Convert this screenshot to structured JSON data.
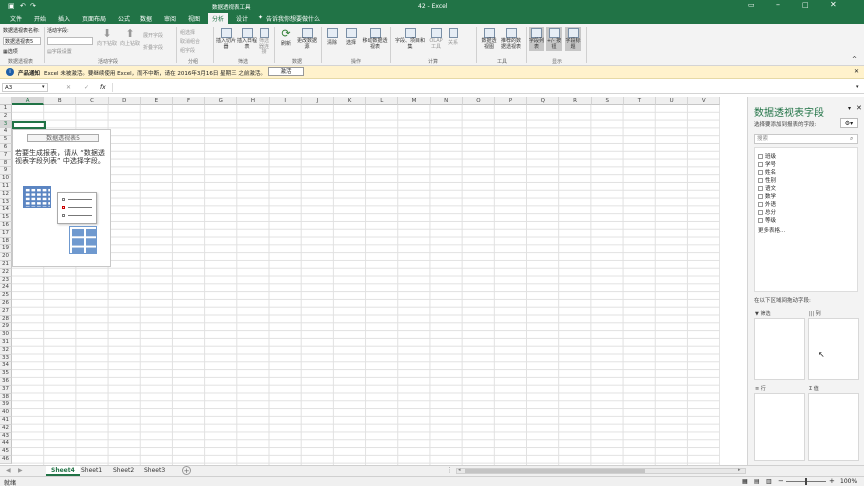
{
  "titlebar": {
    "title": "42 - Excel",
    "context_tool": "数据透视表工具"
  },
  "ribbon_tabs": [
    "文件",
    "开始",
    "插入",
    "页面布局",
    "公式",
    "数据",
    "审阅",
    "视图",
    "分析",
    "设计"
  ],
  "tell_me": "告诉我你想要做什么",
  "ribbon": {
    "pivot_name_label": "数据透视表名称:",
    "pivot_name_value": "数据透视表5",
    "options_label": "选项",
    "active_field_label": "活动字段:",
    "field_settings_label": "字段设置",
    "drill_down": "向下钻取",
    "drill_up": "向上钻取",
    "expand_field": "展开字段",
    "collapse_field": "折叠字段",
    "group_selection": "组选择",
    "ungroup": "取消组合",
    "group_field": "组字段",
    "insert_slicer": "插入切片器",
    "insert_timeline": "插入日程表",
    "filter_connections": "筛选器连接",
    "refresh": "刷新",
    "change_source": "更改数据源",
    "clear": "清除",
    "select": "选择",
    "move_pivot": "移动数据透视表",
    "fields_items": "字段、项目和集",
    "olap_tools": "OLAP 工具",
    "relationships": "关系",
    "pivot_chart": "数据透视图",
    "recommended_pivots": "推荐的数据透视表",
    "field_list": "字段列表",
    "plus_minus": "+/- 按钮",
    "field_headers": "字段标题",
    "groups": [
      "数据透视表",
      "活动字段",
      "分组",
      "筛选",
      "数据",
      "操作",
      "计算",
      "工具",
      "显示"
    ]
  },
  "infobar": {
    "label": "产品通知",
    "message": "Excel 未被激活。要继续使用 Excel，而不中断，请在 2016年3月16日 星期三 之前激活。",
    "button": "激活"
  },
  "formula": {
    "name_box": "A3",
    "fx": "fx",
    "value": ""
  },
  "columns": [
    "A",
    "B",
    "C",
    "D",
    "E",
    "F",
    "G",
    "H",
    "I",
    "J",
    "K",
    "L",
    "M",
    "N",
    "O",
    "P",
    "Q",
    "R",
    "S",
    "T",
    "U",
    "V"
  ],
  "rows": [
    "1",
    "2",
    "3",
    "4",
    "5",
    "6",
    "7",
    "8",
    "9",
    "10",
    "11",
    "12",
    "13",
    "14",
    "15",
    "16",
    "17",
    "18",
    "19",
    "20",
    "21",
    "22",
    "23",
    "24",
    "25",
    "26",
    "27",
    "28",
    "29",
    "30",
    "31",
    "32",
    "33",
    "34",
    "35",
    "36",
    "37",
    "38",
    "39",
    "40",
    "41",
    "42",
    "43",
    "44",
    "45",
    "46"
  ],
  "pivot_placeholder": {
    "title": "数据透视表5",
    "instruction": "若要生成报表，请从 “数据透视表字段列表” 中选择字段。"
  },
  "pane": {
    "title": "数据透视表字段",
    "subtitle": "选择要添加到报表的字段:",
    "search_placeholder": "搜索",
    "fields": [
      "班级",
      "学号",
      "姓名",
      "性别",
      "语文",
      "数学",
      "外语",
      "总分",
      "等级"
    ],
    "more_tables": "更多表格...",
    "drag_hint": "在以下区域间拖动字段:",
    "areas": {
      "filters": "筛选",
      "columns": "列",
      "rows": "行",
      "values": "值"
    }
  },
  "sheets": [
    "Sheet4",
    "Sheet1",
    "Sheet2",
    "Sheet3"
  ],
  "active_sheet": "Sheet4",
  "status": {
    "ready": "就绪",
    "zoom": "100%"
  },
  "colors": {
    "accent": "#217346",
    "info_bg": "#fff2cc"
  }
}
